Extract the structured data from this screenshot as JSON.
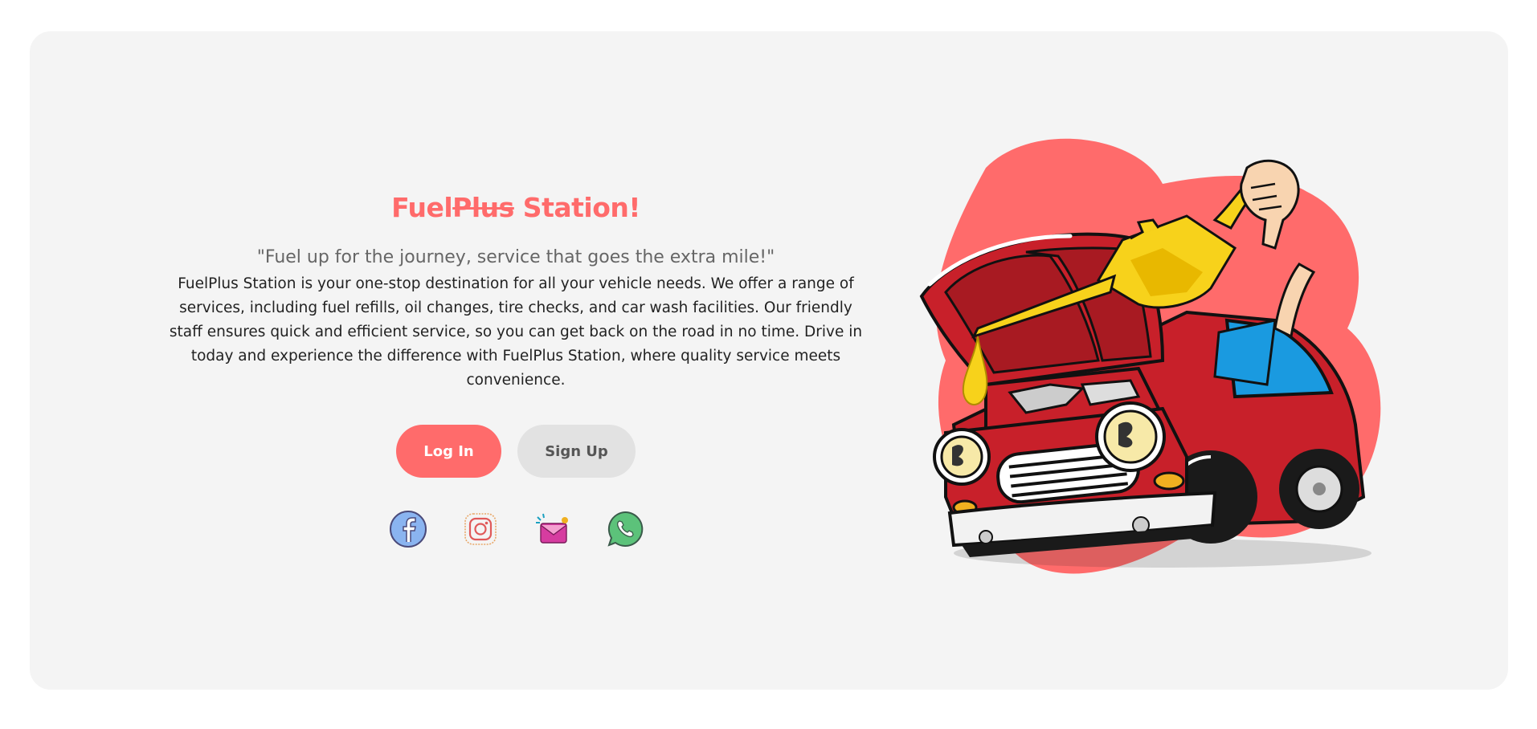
{
  "hero": {
    "title_part1": "Fuel",
    "title_strike": "Plus",
    "title_part2": " Station!",
    "tagline": "\"Fuel up for the journey, service that goes the extra mile!\"",
    "description": "FuelPlus Station is your one-stop destination for all your vehicle needs. We offer a range of services, including fuel refills, oil changes, tire checks, and car wash facilities. Our friendly staff ensures quick and efficient service, so you can get back on the road in no time. Drive in today and experience the difference with FuelPlus Station, where quality service meets convenience."
  },
  "actions": {
    "login_label": "Log In",
    "signup_label": "Sign Up"
  },
  "socials": [
    {
      "icon": "facebook-icon"
    },
    {
      "icon": "instagram-icon"
    },
    {
      "icon": "email-icon"
    },
    {
      "icon": "whatsapp-icon"
    }
  ],
  "colors": {
    "accent": "#ff6b6b",
    "card_background": "#f4f4f4",
    "secondary_button": "#e2e2e2",
    "car_red": "#c8202a",
    "oil_yellow": "#f7d21b"
  }
}
